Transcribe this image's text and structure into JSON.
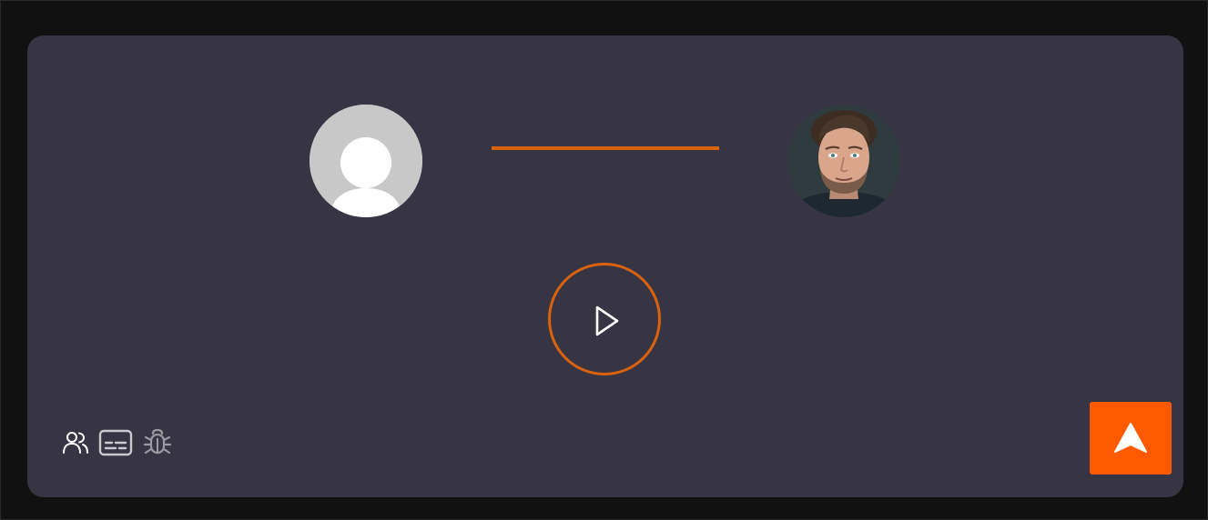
{
  "call": {
    "caller_avatar": "default-user-avatar",
    "callee_avatar": "user-photo-avatar",
    "connector_color": "#d9620f",
    "play_icon": "play-icon"
  },
  "toolbar": {
    "items": [
      {
        "icon": "users-icon"
      },
      {
        "icon": "captions-icon"
      },
      {
        "icon": "bug-icon"
      }
    ]
  },
  "send_button": {
    "icon": "navigation-arrow-icon",
    "color": "#ff5a00"
  },
  "colors": {
    "background": "#111112",
    "panel": "#373543",
    "accent": "#d9620f"
  }
}
